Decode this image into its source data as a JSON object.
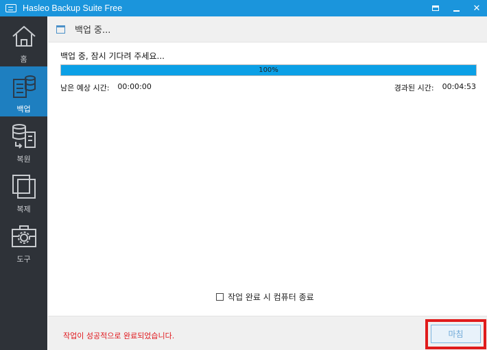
{
  "window": {
    "title": "Hasleo Backup Suite Free"
  },
  "sidebar": {
    "items": [
      {
        "label": "홈",
        "icon": "home-icon",
        "active": false
      },
      {
        "label": "백업",
        "icon": "backup-icon",
        "active": true
      },
      {
        "label": "복원",
        "icon": "restore-icon",
        "active": false
      },
      {
        "label": "복제",
        "icon": "clone-icon",
        "active": false
      },
      {
        "label": "도구",
        "icon": "tools-icon",
        "active": false
      }
    ]
  },
  "header": {
    "title": "백업 중..."
  },
  "progress": {
    "status": "백업 중, 잠시 기다려 주세요...",
    "percent_label": "100%",
    "value": 1.0,
    "remaining_label": "남은 예상 시간:",
    "remaining_value": "00:00:00",
    "elapsed_label": "경과된 시간:",
    "elapsed_value": "00:04:53"
  },
  "shutdown_option": {
    "label": "작업 완료 시 컴퓨터 종료",
    "checked": false
  },
  "footer": {
    "success_message": "작업이 성공적으로 완료되었습니다.",
    "finish_label": "마침"
  },
  "colors": {
    "titlebar": "#1b95dc",
    "sidebar": "#2e3238",
    "active_nav": "#1e7fc0",
    "progress_fill": "#0ba0e6",
    "success_text": "#e0161b",
    "highlight": "#e01b1b"
  }
}
